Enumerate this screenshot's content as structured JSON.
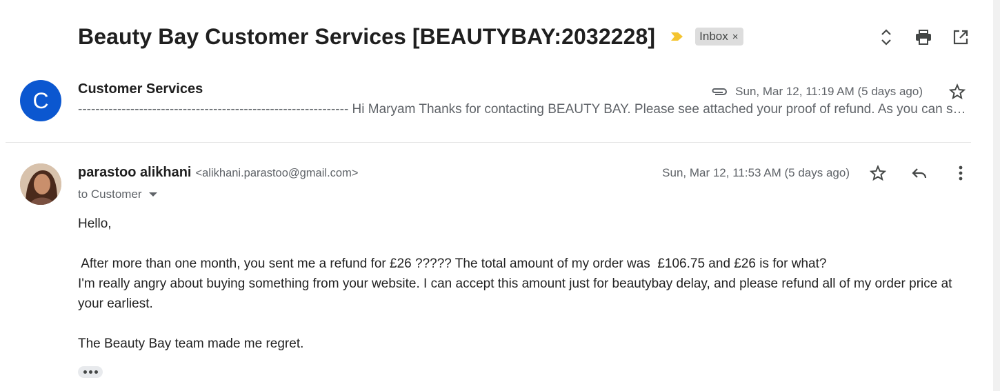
{
  "thread": {
    "subject": "Beauty Bay Customer Services [BEAUTYBAY:2032228]",
    "label": "Inbox",
    "label_remove": "×"
  },
  "messages": [
    {
      "avatar_letter": "C",
      "sender": "Customer Services",
      "date": "Sun, Mar 12, 11:19 AM (5 days ago)",
      "snippet": "-------------------------------------------------------------- Hi Maryam Thanks for contacting BEAUTY BAY. Please see attached your proof of refund. As you can see the refund has been processed"
    },
    {
      "sender": "parastoo alikhani",
      "email": "<alikhani.parastoo@gmail.com>",
      "to": "to Customer",
      "date": "Sun, Mar 12, 11:53 AM (5 days ago)",
      "body": {
        "greeting": "Hello,",
        "line1": " After more than one month, you sent me a refund for £26 ????? The total amount of my order was  £106.75 and £26 is for what?",
        "line2": "I'm really angry about buying something from your website. I can accept this amount just for beautybay delay, and please refund all of my order price at your earliest.",
        "line3": "The Beauty Bay team made me regret."
      }
    }
  ],
  "colors": {
    "avatar_blue": "#0b57d0",
    "importance_yellow": "#f4c430",
    "chip_bg": "#dddddd"
  },
  "icons": [
    "importance-marker-icon",
    "expand-collapse-icon",
    "print-icon",
    "open-new-window-icon",
    "attachment-icon",
    "star-icon",
    "reply-icon",
    "more-vert-icon"
  ]
}
